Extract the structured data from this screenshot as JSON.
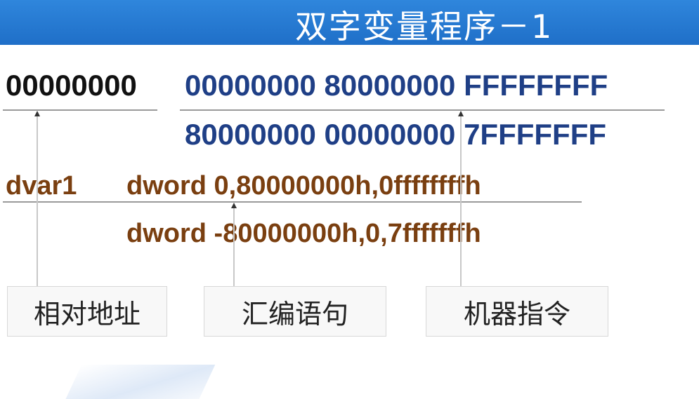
{
  "title": "双字变量程序－1",
  "relative_address": "00000000",
  "machine_code": {
    "line1": "00000000 80000000 FFFFFFFF",
    "line2": "80000000 00000000 7FFFFFFF"
  },
  "assembly": {
    "var_name": "dvar1",
    "line1": "dword 0,80000000h,0ffffffffh",
    "line2": "dword -80000000h,0,7fffffffh"
  },
  "labels": {
    "relative_address": "相对地址",
    "assembly_statement": "汇编语句",
    "machine_instruction": "机器指令"
  },
  "colors": {
    "title_bar": "#1f6fc8",
    "machine_code": "#1f3f86",
    "assembly": "#7a3f10",
    "address": "#111111"
  }
}
